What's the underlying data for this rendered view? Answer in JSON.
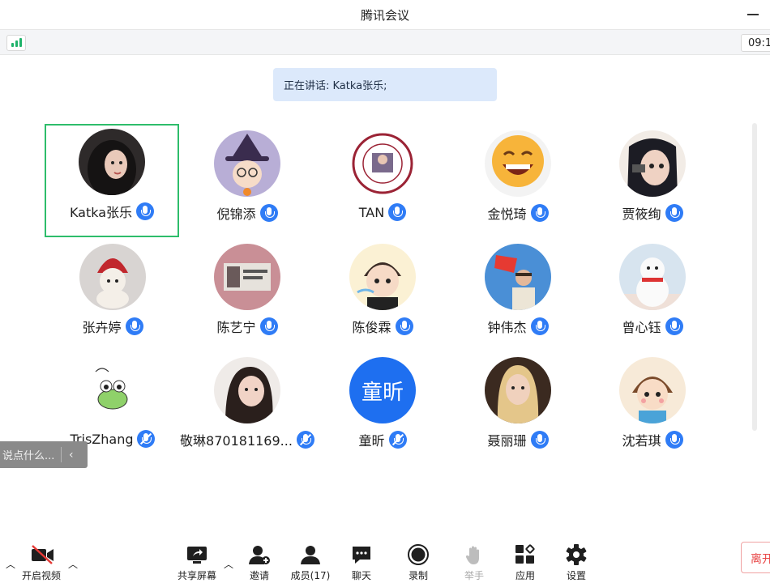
{
  "window": {
    "title": "腾讯会议"
  },
  "status": {
    "timer": "09:1"
  },
  "banner": {
    "speaking": "正在讲话: Katka张乐;"
  },
  "participants": [
    {
      "name": "Katka张乐",
      "mic": "on",
      "avatar": "dark-hair-girl-avatar",
      "active": true
    },
    {
      "name": "倪锦添",
      "mic": "on",
      "avatar": "witch-cartoon-avatar"
    },
    {
      "name": "TAN",
      "mic": "on",
      "avatar": "university-seal-avatar"
    },
    {
      "name": "金悦琦",
      "mic": "on",
      "avatar": "laughing-emoji-avatar"
    },
    {
      "name": "贾筱绚",
      "mic": "on",
      "avatar": "anime-girl-avatar"
    },
    {
      "name": "张卉婷",
      "mic": "on",
      "avatar": "knit-doll-avatar"
    },
    {
      "name": "陈艺宁",
      "mic": "on",
      "avatar": "photo-sign-avatar"
    },
    {
      "name": "陈俊霖",
      "mic": "on",
      "avatar": "cartoon-boy-avatar"
    },
    {
      "name": "钟伟杰",
      "mic": "on",
      "avatar": "flag-person-avatar"
    },
    {
      "name": "曾心钰",
      "mic": "on",
      "avatar": "snowman-avatar"
    },
    {
      "name": "TrisZhang",
      "mic": "muted",
      "avatar": "frog-doodle-avatar"
    },
    {
      "name": "敬琳870181169...",
      "mic": "muted",
      "avatar": "woman-portrait-avatar"
    },
    {
      "name": "童昕",
      "mic": "muted",
      "avatar": "text-avatar",
      "avatar_text": "童昕",
      "avatar_color": "#1e6ff0"
    },
    {
      "name": "聂丽珊",
      "mic": "on",
      "avatar": "blonde-portrait-avatar"
    },
    {
      "name": "沈若琪",
      "mic": "on",
      "avatar": "cartoon-girl-avatar"
    }
  ],
  "quick_chat": {
    "placeholder": "说点什么...",
    "arrow": "‹"
  },
  "toolbar": {
    "video": "开启视频",
    "share": "共享屏幕",
    "invite": "邀请",
    "members": "成员(17)",
    "chat": "聊天",
    "record": "录制",
    "raise_hand": "举手",
    "apps": "应用",
    "settings": "设置",
    "leave": "离开"
  },
  "colors": {
    "active_border": "#2ebd6b",
    "mic_blue": "#2f7cf6",
    "leave_red": "#e84545",
    "banner_bg": "#dce9fb"
  }
}
